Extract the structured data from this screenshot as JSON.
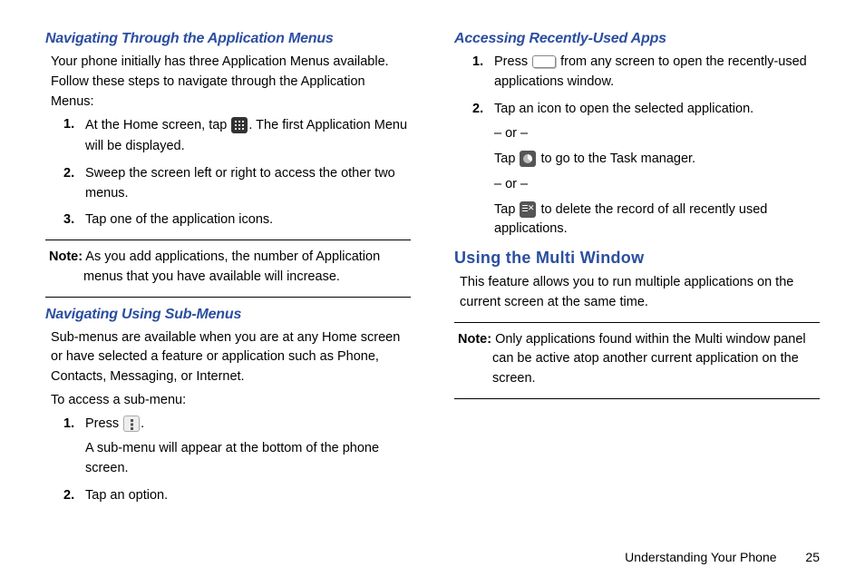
{
  "left": {
    "sec1": {
      "heading": "Navigating Through the Application Menus",
      "intro": "Your phone initially has three Application Menus available. Follow these steps to navigate through the Application Menus:",
      "steps": {
        "s1a": "At the Home screen, tap ",
        "s1b": ". The first Application Menu will be displayed.",
        "s2": "Sweep the screen left or right to access the other two menus.",
        "s3": "Tap one of the application icons."
      },
      "note_label": "Note:",
      "note": "As you add applications, the number of Application menus that you have available will increase."
    },
    "sec2": {
      "heading": "Navigating Using Sub-Menus",
      "p1": "Sub-menus are available when you are at any Home screen or have selected a feature or application such as Phone, Contacts, Messaging, or Internet.",
      "p2": "To access a sub-menu:",
      "steps": {
        "s1a": "Press ",
        "s1b": ".",
        "s1c": "A sub-menu will appear at the bottom of the phone screen.",
        "s2": "Tap an option."
      }
    }
  },
  "right": {
    "sec1": {
      "heading": "Accessing Recently-Used Apps",
      "steps": {
        "s1a": "Press ",
        "s1b": " from any screen to open the recently-used applications window.",
        "s2": "Tap an icon to open the selected application.",
        "or": "– or –",
        "s2b_a": "Tap ",
        "s2b_b": " to go to the Task manager.",
        "s2c_a": "Tap ",
        "s2c_b": " to delete the record of all recently used applications."
      }
    },
    "sec2": {
      "heading": "Using the Multi Window",
      "p1": "This feature allows you to run multiple applications on the current screen at the same time.",
      "note_label": "Note:",
      "note": "Only applications found within the Multi window panel can be active atop another current application on the screen."
    }
  },
  "footer": {
    "section": "Understanding Your Phone",
    "page": "25"
  }
}
